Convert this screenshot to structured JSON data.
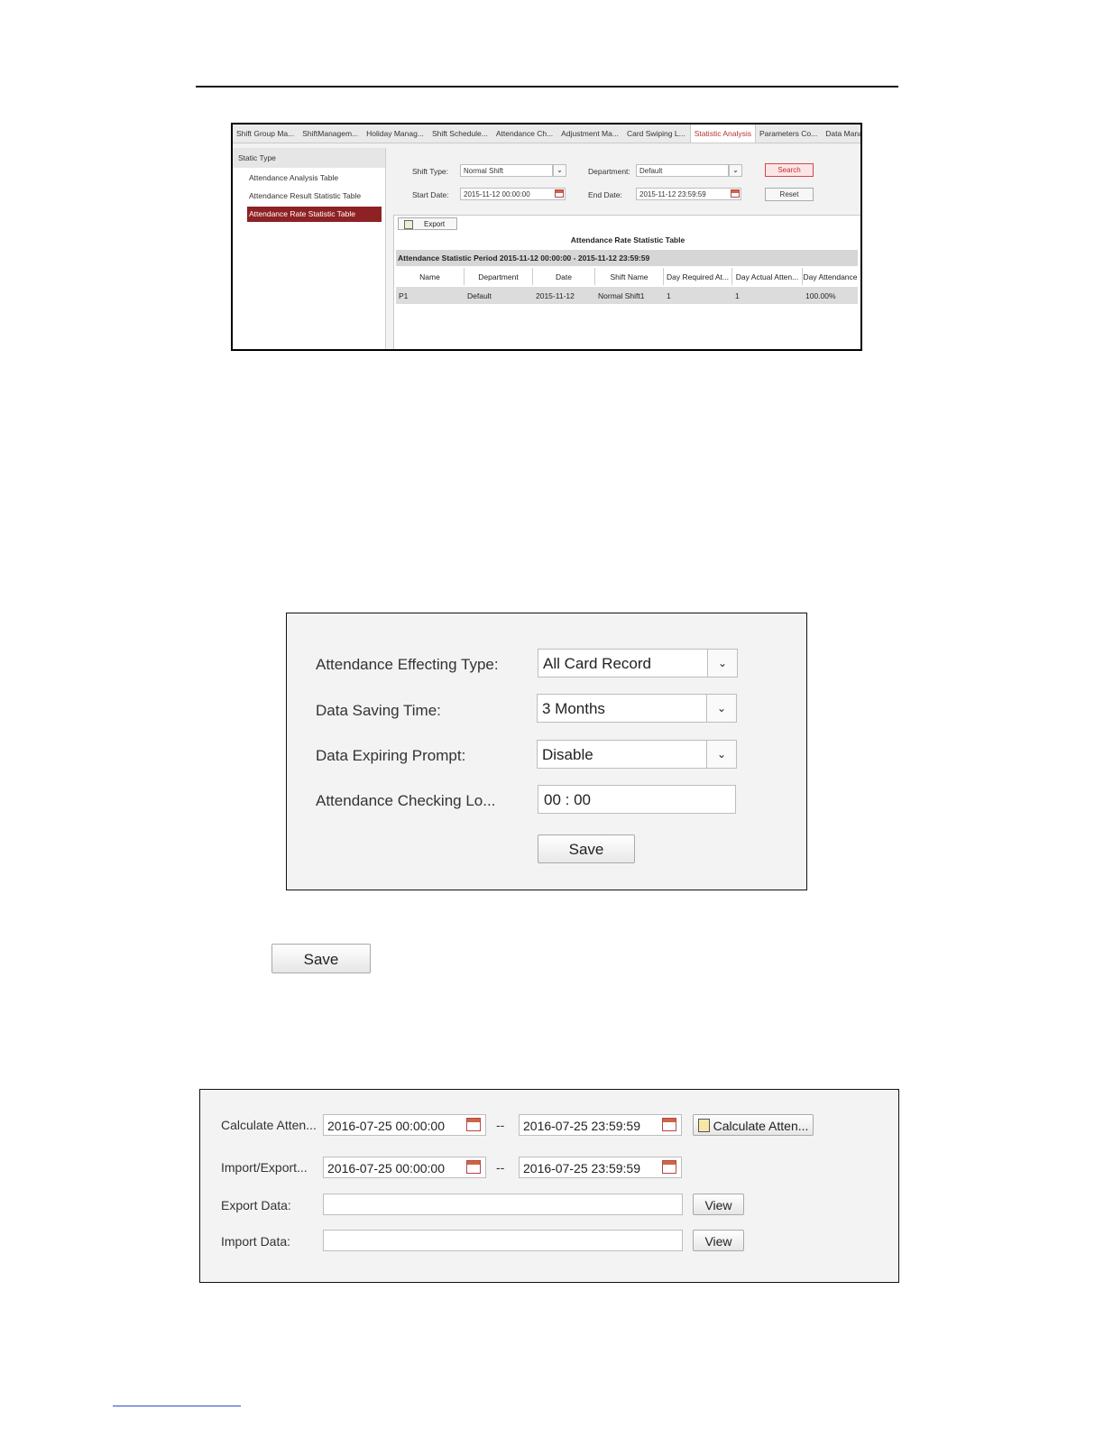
{
  "shot1": {
    "tabs": [
      "Shift Group Ma...",
      "ShiftManagem...",
      "Holiday Manag...",
      "Shift Schedule...",
      "Attendance Ch...",
      "Adjustment Ma...",
      "Card Swiping L...",
      "Statistic Analysis",
      "Parameters Co...",
      "Data Manage..."
    ],
    "left_header": "Static Type",
    "left_items": [
      "Attendance Analysis Table",
      "Attendance Result Statistic Table",
      "Attendance Rate Statistic Table"
    ],
    "shift_type_label": "Shift Type:",
    "shift_type_value": "Normal Shift",
    "department_label": "Department:",
    "department_value": "Default",
    "search_label": "Search",
    "start_date_label": "Start Date:",
    "start_date_value": "2015-11-12 00:00:00",
    "end_date_label": "End Date:",
    "end_date_value": "2015-11-12 23:59:59",
    "reset_label": "Reset",
    "export_label": "Export",
    "table_title": "Attendance Rate Statistic Table",
    "period": "Attendance Statistic Period 2015-11-12 00:00:00 - 2015-11-12 23:59:59",
    "columns": [
      "Name",
      "Department",
      "Date",
      "Shift Name",
      "Day Required At...",
      "Day Actual Atten...",
      "Day Attendance"
    ],
    "rows": [
      [
        "P1",
        "Default",
        "2015-11-12",
        "Normal Shift1",
        "1",
        "1",
        "100.00%"
      ]
    ]
  },
  "shot2": {
    "effecting_type_label": "Attendance Effecting Type:",
    "effecting_type_value": "All Card Record",
    "saving_time_label": "Data Saving Time:",
    "saving_time_value": "3 Months",
    "expiring_prompt_label": "Data Expiring Prompt:",
    "expiring_prompt_value": "Disable",
    "checking_label": "Attendance Checking Lo...",
    "checking_value": "00 : 00",
    "save_label": "Save"
  },
  "standalone_save_label": "Save",
  "shot3": {
    "calc_label": "Calculate Atten...",
    "calc_start": "2016-07-25 00:00:00",
    "calc_end": "2016-07-25 23:59:59",
    "calc_button": "Calculate Atten...",
    "ie_label": "Import/Export...",
    "ie_start": "2016-07-25 00:00:00",
    "ie_end": "2016-07-25 23:59:59",
    "dash": "--",
    "export_label": "Export Data:",
    "import_label": "Import Data:",
    "view_label": "View"
  }
}
